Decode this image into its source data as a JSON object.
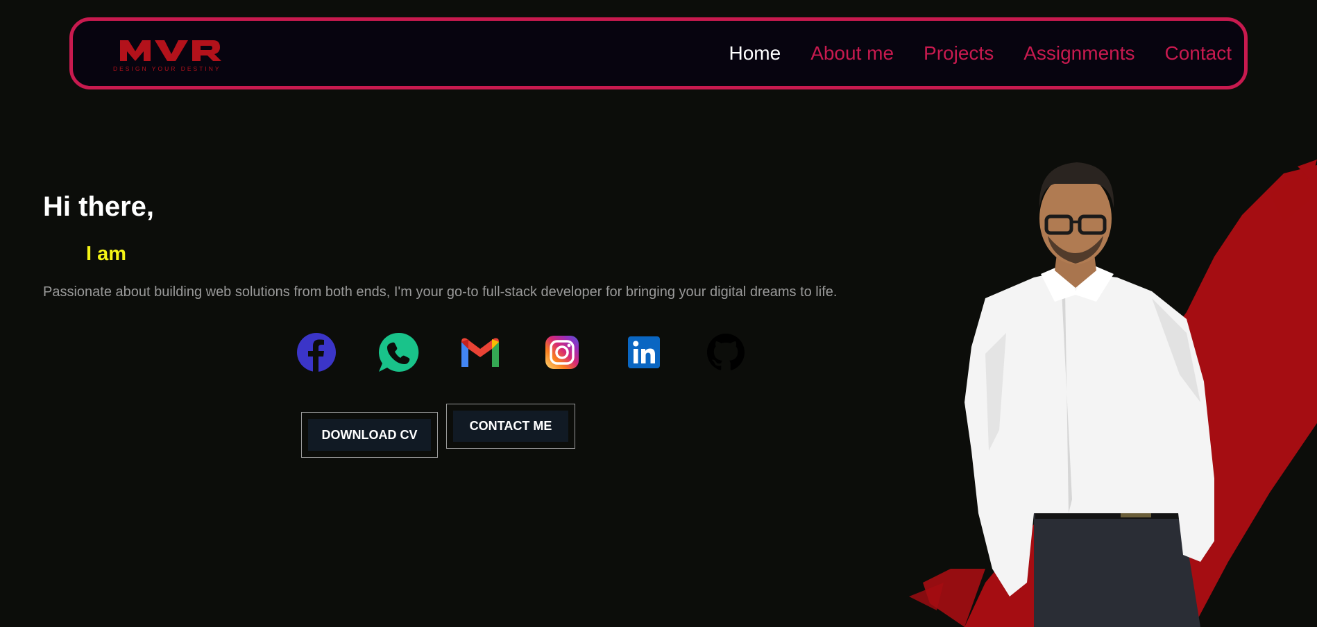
{
  "nav": {
    "logo_text": "MVR",
    "logo_tagline": "DESIGN YOUR DESTINY",
    "links": [
      "Home",
      "About me",
      "Projects",
      "Assignments",
      "Contact"
    ],
    "active": "Home"
  },
  "hero": {
    "greeting": "Hi there,",
    "intro": "I am",
    "tagline": "Passionate about building web solutions from both ends, I'm your go-to full-stack developer for bringing your digital dreams to life."
  },
  "socials": [
    {
      "name": "facebook-icon",
      "color": "#3b35c8"
    },
    {
      "name": "whatsapp-icon",
      "color": "#19c38a"
    },
    {
      "name": "gmail-icon",
      "color": "#ea4335"
    },
    {
      "name": "instagram-icon",
      "color": "#e1306c"
    },
    {
      "name": "linkedin-icon",
      "color": "#0a66c2"
    },
    {
      "name": "github-icon",
      "color": "#000000"
    }
  ],
  "buttons": {
    "download_cv": "DOWNLOAD CV",
    "contact_me": "CONTACT ME"
  },
  "colors": {
    "accent": "#c81a4f",
    "highlight": "#f5f516",
    "background": "#0c0d0a",
    "brush": "#a50d12"
  }
}
